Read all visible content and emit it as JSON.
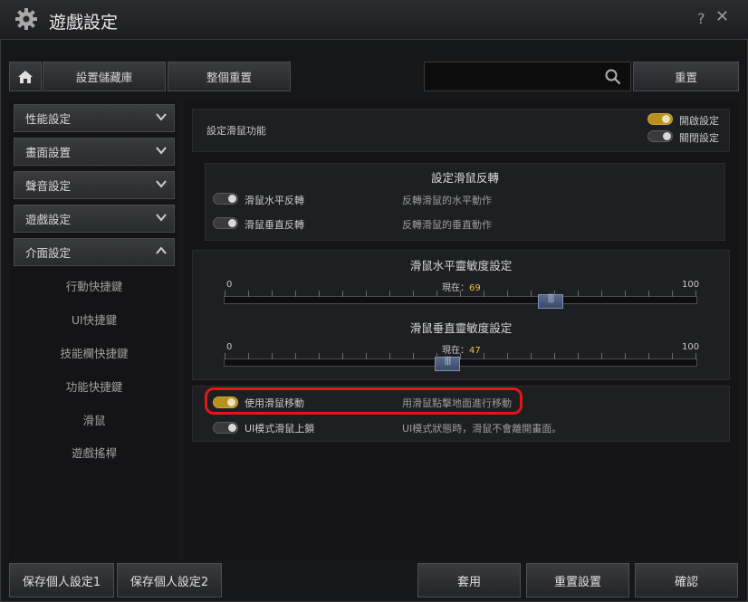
{
  "window": {
    "title": "遊戲設定",
    "help": "?",
    "close": "✕"
  },
  "toolbar": {
    "home_icon": "home-icon",
    "storage_label": "設置儲藏庫",
    "reset_all_label": "整個重置",
    "search_placeholder": "",
    "reset_label": "重置"
  },
  "sidebar": {
    "categories": [
      {
        "label": "性能設定",
        "expanded": false
      },
      {
        "label": "畫面設置",
        "expanded": false
      },
      {
        "label": "聲音設定",
        "expanded": false
      },
      {
        "label": "遊戲設定",
        "expanded": false
      },
      {
        "label": "介面設定",
        "expanded": true
      }
    ],
    "subitems": [
      "行動快捷鍵",
      "UI快捷鍵",
      "技能欄快捷鍵",
      "功能快捷鍵",
      "滑鼠",
      "遊戲搖桿"
    ]
  },
  "mouse_function": {
    "label": "設定滑鼠功能",
    "legend_on": "開啟設定",
    "legend_off": "關閉設定"
  },
  "invert": {
    "heading": "設定滑鼠反轉",
    "rows": [
      {
        "label": "滑鼠水平反轉",
        "desc": "反轉滑鼠的水平動作",
        "on": false
      },
      {
        "label": "滑鼠垂直反轉",
        "desc": "反轉滑鼠的垂直動作",
        "on": false
      }
    ]
  },
  "sensitivity": {
    "horizontal": {
      "heading": "滑鼠水平靈敏度設定",
      "min": "0",
      "max": "100",
      "current_prefix": "現在：",
      "value": 69
    },
    "vertical": {
      "heading": "滑鼠垂直靈敏度設定",
      "min": "0",
      "max": "100",
      "current_prefix": "現在：",
      "value": 47
    }
  },
  "options": [
    {
      "label": "使用滑鼠移動",
      "desc": "用滑鼠點擊地面進行移動",
      "on": true
    },
    {
      "label": "UI模式滑鼠上鎖",
      "desc": "UI模式狀態時，滑鼠不會離開畫面。",
      "on": false
    }
  ],
  "footer": {
    "save1": "保存個人設定1",
    "save2": "保存個人設定2",
    "apply": "套用",
    "reset_settings": "重置設置",
    "confirm": "確認"
  },
  "colors": {
    "accent_toggle": "#b8901e",
    "highlight": "#e01818",
    "value_text": "#e6c24a"
  }
}
